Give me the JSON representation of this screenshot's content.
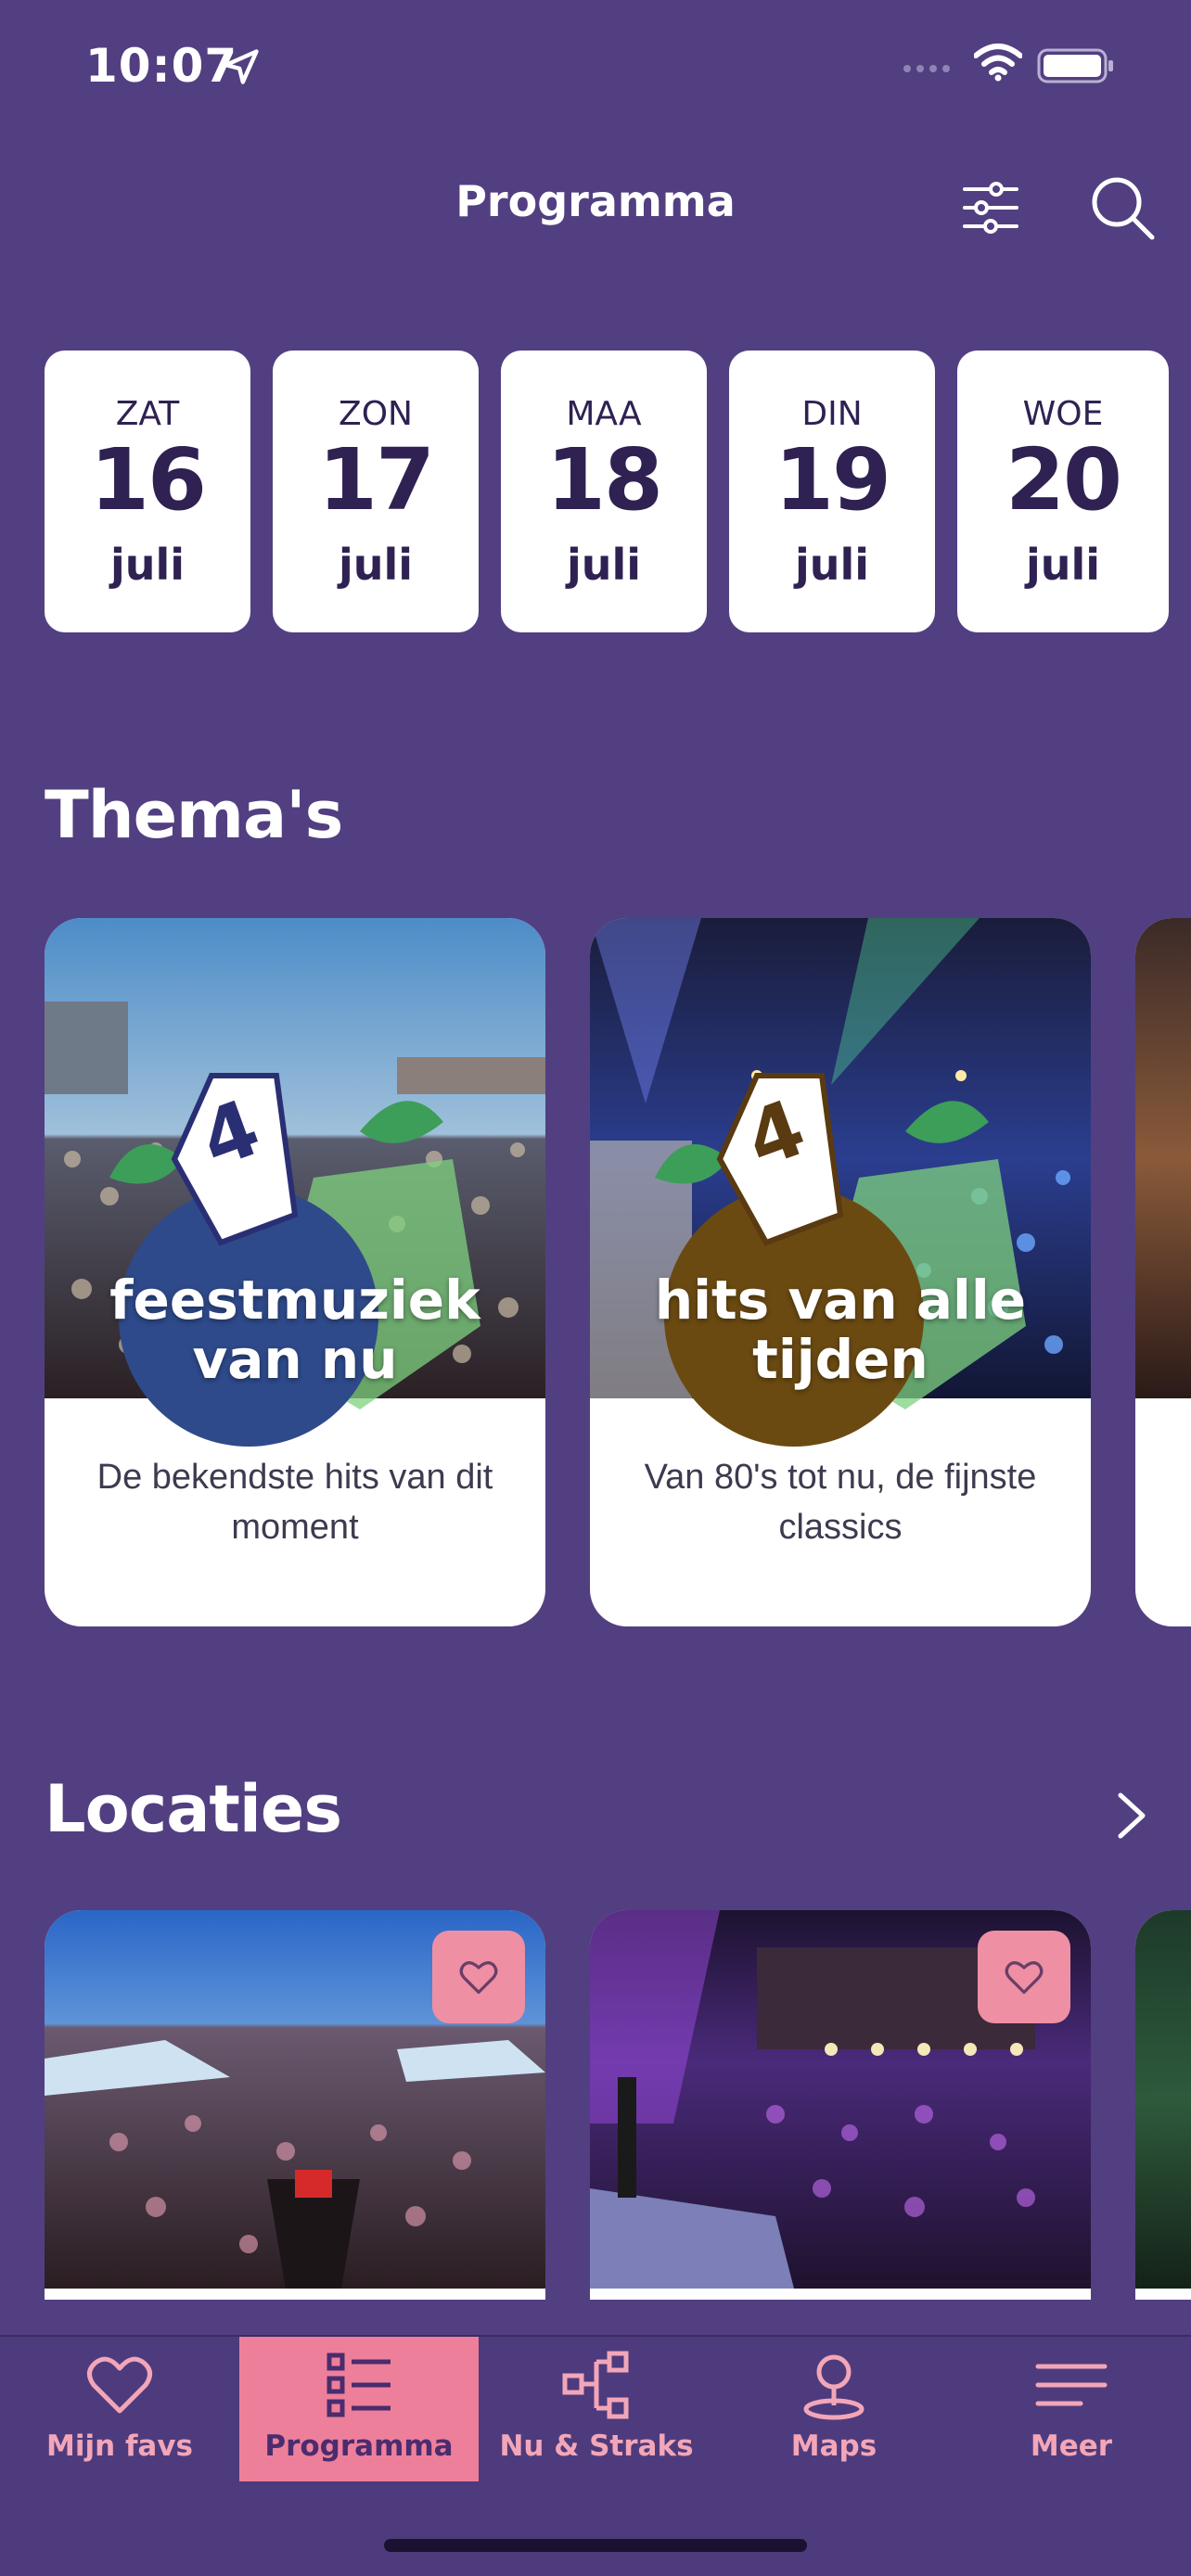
{
  "status": {
    "time": "10:07"
  },
  "header": {
    "title": "Programma"
  },
  "days": [
    {
      "name": "ZAT",
      "num": "16",
      "month": "juli"
    },
    {
      "name": "ZON",
      "num": "17",
      "month": "juli"
    },
    {
      "name": "MAA",
      "num": "18",
      "month": "juli"
    },
    {
      "name": "DIN",
      "num": "19",
      "month": "juli"
    },
    {
      "name": "WOE",
      "num": "20",
      "month": "juli"
    }
  ],
  "themes": {
    "title": "Thema's",
    "items": [
      {
        "badge": "feestmuziek van nu",
        "description": "De bekendste hits van dit moment",
        "logo": "4 DAAGSE FEESTEN",
        "circle_color": "#2e4a8a"
      },
      {
        "badge": "hits van alle tijden",
        "description": "Van 80's tot nu, de fijnste classics",
        "logo": "4 DAAGSE FEESTEN",
        "circle_color": "#6b4a12"
      }
    ]
  },
  "locations": {
    "title": "Locaties"
  },
  "tabs": [
    {
      "label": "Mijn favs",
      "icon": "heart-icon"
    },
    {
      "label": "Programma",
      "icon": "list-icon"
    },
    {
      "label": "Nu & Straks",
      "icon": "flow-icon"
    },
    {
      "label": "Maps",
      "icon": "map-pin-icon"
    },
    {
      "label": "Meer",
      "icon": "menu-icon"
    }
  ],
  "colors": {
    "background": "#523f81",
    "accent": "#ee7f9a",
    "card": "#ffffff",
    "text_dark": "#2f2152"
  }
}
